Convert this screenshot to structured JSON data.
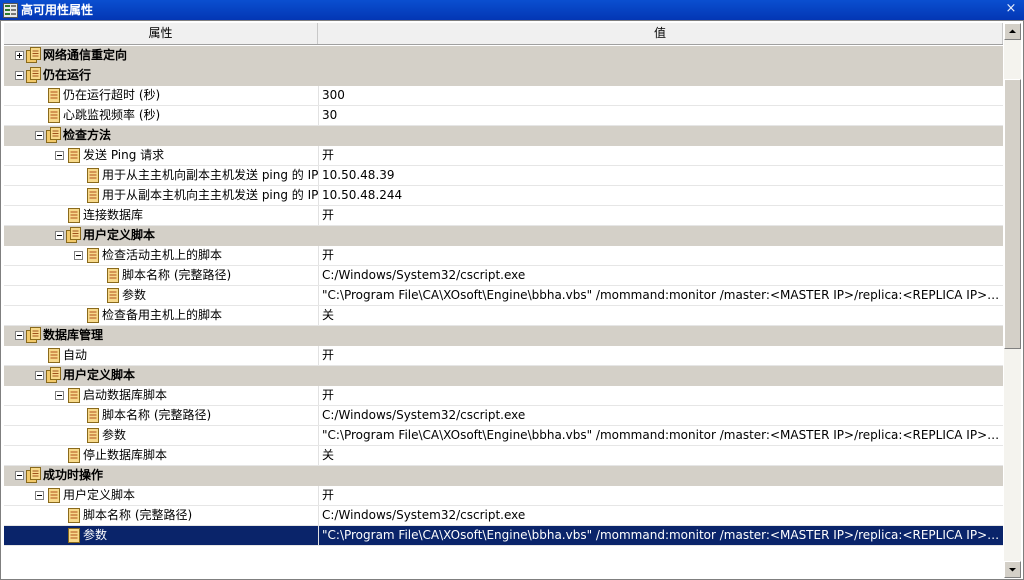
{
  "window": {
    "title": "高可用性属性",
    "close_glyph": "×"
  },
  "table": {
    "header_property": "属性",
    "header_value": "值"
  },
  "rows": [
    {
      "type": "cat",
      "level": 0,
      "toggle": "plus",
      "icon": "folder",
      "label": "网络通信重定向",
      "value": ""
    },
    {
      "type": "cat",
      "level": 0,
      "toggle": "minus",
      "icon": "folder",
      "label": "仍在运行",
      "value": ""
    },
    {
      "type": "prop",
      "level": 1,
      "toggle": "",
      "icon": "item",
      "label": "仍在运行超时 (秒)",
      "value": "300"
    },
    {
      "type": "prop",
      "level": 1,
      "toggle": "",
      "icon": "item",
      "label": "心跳监视频率 (秒)",
      "value": "30"
    },
    {
      "type": "cat",
      "level": 1,
      "toggle": "minus",
      "icon": "folder",
      "label": "检查方法",
      "value": ""
    },
    {
      "type": "prop",
      "level": 2,
      "toggle": "minus",
      "icon": "item",
      "label": "发送 Ping 请求",
      "value": "开"
    },
    {
      "type": "prop",
      "level": 3,
      "toggle": "",
      "icon": "item",
      "label": "用于从主主机向副本主机发送 ping 的 IP",
      "value": "10.50.48.39"
    },
    {
      "type": "prop",
      "level": 3,
      "toggle": "",
      "icon": "item",
      "label": "用于从副本主机向主主机发送 ping 的 IP",
      "value": "10.50.48.244"
    },
    {
      "type": "prop",
      "level": 2,
      "toggle": "",
      "icon": "item",
      "label": "连接数据库",
      "value": "开"
    },
    {
      "type": "cat",
      "level": 2,
      "toggle": "minus",
      "icon": "folder",
      "label": "用户定义脚本",
      "value": ""
    },
    {
      "type": "prop",
      "level": 3,
      "toggle": "minus",
      "icon": "item",
      "label": "检查活动主机上的脚本",
      "value": "开"
    },
    {
      "type": "prop",
      "level": 4,
      "toggle": "",
      "icon": "item",
      "label": "脚本名称 (完整路径)",
      "value": "C:/Windows/System32/cscript.exe"
    },
    {
      "type": "prop",
      "level": 4,
      "toggle": "",
      "icon": "item",
      "label": "参数",
      "value": "\"C:\\Program File\\CA\\XOsoft\\Engine\\bbha.vbs\" /mommand:monitor /master:<MASTER IP>/replica:<REPLICA IP>/fqdn:<MAST..."
    },
    {
      "type": "prop",
      "level": 3,
      "toggle": "",
      "icon": "item",
      "label": "检查备用主机上的脚本",
      "value": "关"
    },
    {
      "type": "cat",
      "level": 0,
      "toggle": "minus",
      "icon": "folder",
      "label": "数据库管理",
      "value": ""
    },
    {
      "type": "prop",
      "level": 1,
      "toggle": "",
      "icon": "item",
      "label": "自动",
      "value": "开"
    },
    {
      "type": "cat",
      "level": 1,
      "toggle": "minus",
      "icon": "folder",
      "label": "用户定义脚本",
      "value": ""
    },
    {
      "type": "prop",
      "level": 2,
      "toggle": "minus",
      "icon": "item",
      "label": "启动数据库脚本",
      "value": "开"
    },
    {
      "type": "prop",
      "level": 3,
      "toggle": "",
      "icon": "item",
      "label": "脚本名称 (完整路径)",
      "value": "C:/Windows/System32/cscript.exe"
    },
    {
      "type": "prop",
      "level": 3,
      "toggle": "",
      "icon": "item",
      "label": "参数",
      "value": "\"C:\\Program File\\CA\\XOsoft\\Engine\\bbha.vbs\" /mommand:monitor /master:<MASTER IP>/replica:<REPLICA IP>/fqdn:<MAST..."
    },
    {
      "type": "prop",
      "level": 2,
      "toggle": "",
      "icon": "item",
      "label": "停止数据库脚本",
      "value": "关"
    },
    {
      "type": "cat",
      "level": 0,
      "toggle": "minus",
      "icon": "folder",
      "label": "成功时操作",
      "value": ""
    },
    {
      "type": "prop",
      "level": 1,
      "toggle": "minus",
      "icon": "item",
      "label": "用户定义脚本",
      "value": "开"
    },
    {
      "type": "prop",
      "level": 2,
      "toggle": "",
      "icon": "item",
      "label": "脚本名称 (完整路径)",
      "value": "C:/Windows/System32/cscript.exe"
    },
    {
      "type": "sel",
      "level": 2,
      "toggle": "",
      "icon": "item",
      "label": "参数",
      "value": "\"C:\\Program File\\CA\\XOsoft\\Engine\\bbha.vbs\" /mommand:monitor /master:<MASTER IP>/replica:<REPLICA IP>/fqdn:<MAST..."
    }
  ],
  "colors": {
    "titlebar": "#0a4fd0",
    "category_row": "#d4d0c8",
    "selected_row": "#0a246a"
  }
}
